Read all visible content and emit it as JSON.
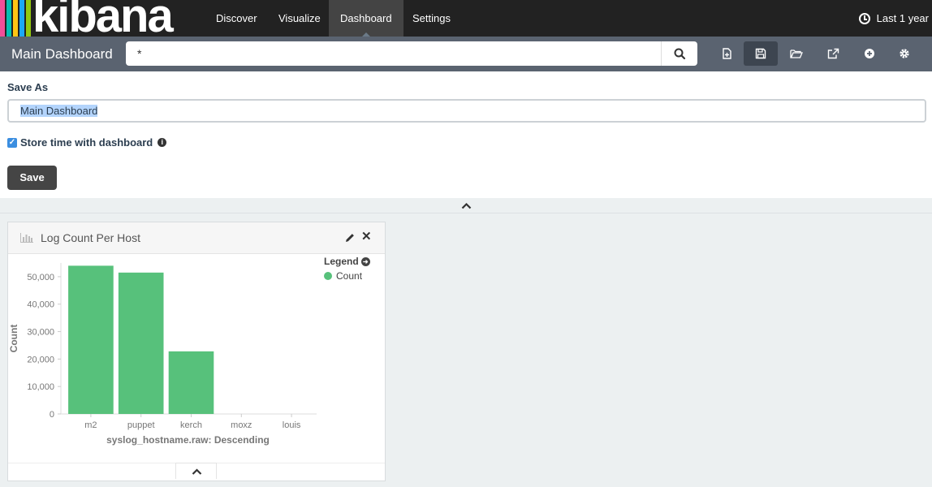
{
  "app": {
    "logo_text": "kibana",
    "logo_bar_colors": [
      "#f04e98",
      "#00bfb3",
      "#fec514",
      "#1ba9f5",
      "#93c90e"
    ]
  },
  "nav": {
    "items": [
      {
        "label": "Discover",
        "active": false
      },
      {
        "label": "Visualize",
        "active": false
      },
      {
        "label": "Dashboard",
        "active": true
      },
      {
        "label": "Settings",
        "active": false
      }
    ],
    "timepicker_label": "Last 1 year"
  },
  "toolbar": {
    "title": "Main Dashboard",
    "query_value": "*",
    "icons": [
      "new-dashboard-icon",
      "save-icon",
      "open-folder-icon",
      "share-icon",
      "add-panel-icon",
      "gear-icon"
    ]
  },
  "save_panel": {
    "label": "Save As",
    "input_value": "Main Dashboard",
    "checkbox_label": "Store time with dashboard",
    "checkbox_checked": true,
    "save_button_label": "Save"
  },
  "panel": {
    "title": "Log Count Per Host",
    "legend_title": "Legend",
    "legend_entries": [
      {
        "label": "Count",
        "color": "#57c17b"
      }
    ]
  },
  "chart_data": {
    "type": "bar",
    "title": "Log Count Per Host",
    "categories": [
      "m2",
      "puppet",
      "kerch",
      "moxz",
      "louis"
    ],
    "series": [
      {
        "name": "Count",
        "values": [
          54000,
          51500,
          22800,
          0,
          0
        ],
        "color": "#57c17b"
      }
    ],
    "xlabel": "syslog_hostname.raw: Descending",
    "ylabel": "Count",
    "ylim": [
      0,
      55000
    ],
    "yticks": [
      0,
      10000,
      20000,
      30000,
      40000,
      50000
    ],
    "ytick_labels": [
      "0",
      "10,000",
      "20,000",
      "30,000",
      "40,000",
      "50,000"
    ],
    "grid": false,
    "legend": "top-right"
  }
}
